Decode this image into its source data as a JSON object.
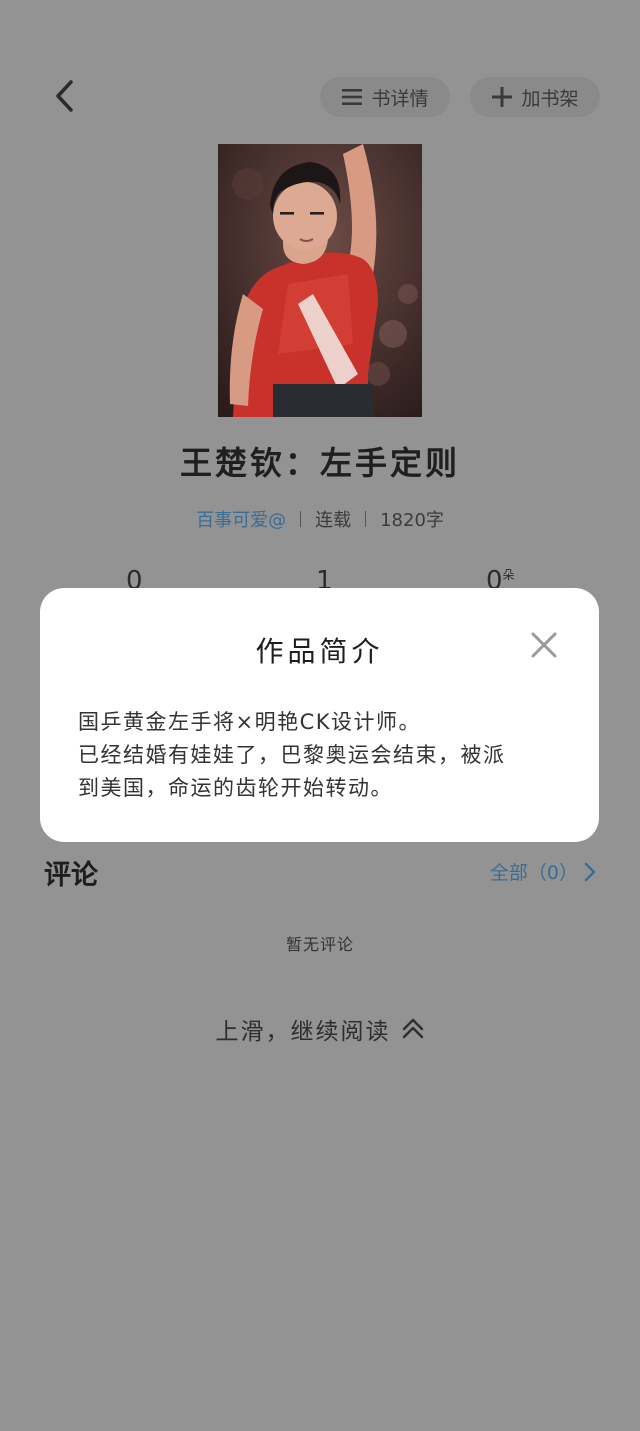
{
  "header": {
    "details_label": "书详情",
    "add_shelf_label": "加书架"
  },
  "book": {
    "title": "王楚钦：左手定则",
    "author": "百事可爱@",
    "status": "连载",
    "word_count": "1820字"
  },
  "stats": {
    "first": "0",
    "second": "1",
    "third": "0",
    "third_unit": "朵"
  },
  "intro_modal": {
    "title": "作品简介",
    "lines": [
      "国乒黄金左手将×明艳CK设计师。",
      "已经结婚有娃娃了，巴黎奥运会结束，被派",
      "到美国，命运的齿轮开始转动。"
    ]
  },
  "comments": {
    "heading": "评论",
    "all_label": "全部（0）",
    "empty_text": "暂无评论"
  },
  "footer": {
    "continue_label": "上滑，继续阅读"
  },
  "colors": {
    "overlay_bg": "#939393",
    "accent_link": "#3a6d96",
    "modal_bg": "#ffffff",
    "jersey_red": "#c8322b"
  }
}
